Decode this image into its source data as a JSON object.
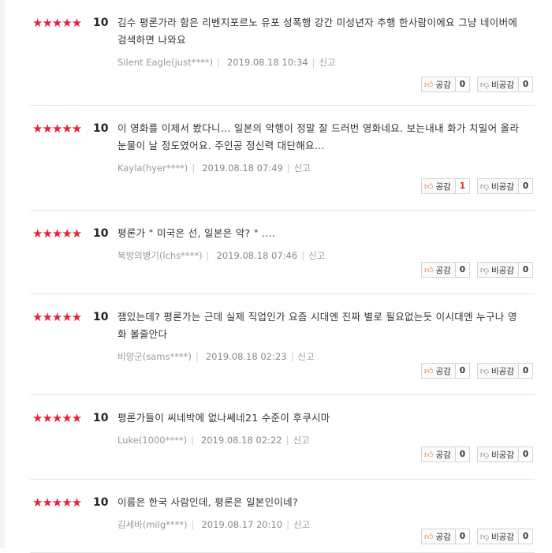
{
  "reviews": [
    {
      "stars": "★★★★★",
      "score": "10",
      "text": "김수 평론가라 함은 리벤지포르노 유포 성폭행 강간 미성년자 추행 한사람이에요 그냥 네이버에 검색하면 나와요",
      "author": "Silent Eagle(just****)",
      "date": "2019.08.18 10:34",
      "report": "신고",
      "like_label": "공감",
      "like": "0",
      "dislike_label": "비공감",
      "dislike": "0"
    },
    {
      "stars": "★★★★★",
      "score": "10",
      "text": "이 영화를 이제서 봤다니... 일본의 악행이 정말 잘 드러번 영화네요. 보는내내 화가 치밀어 올라 눈물이 날 정도였어요. 주인공 정신력 대단해요...",
      "author": "Kayla(hyer****)",
      "date": "2019.08.18 07:49",
      "report": "신고",
      "like_label": "공감",
      "like": "1",
      "dislike_label": "비공감",
      "dislike": "0"
    },
    {
      "stars": "★★★★★",
      "score": "10",
      "text": "평론가 \" 미국은 선, 일본은 악? \" ....",
      "author": "북방의병기(lchs****)",
      "date": "2019.08.18 07:46",
      "report": "신고",
      "like_label": "공감",
      "like": "0",
      "dislike_label": "비공감",
      "dislike": "0"
    },
    {
      "stars": "★★★★★",
      "score": "10",
      "text": "잼있는데? 평론가는 근데 실제 직업인가 요즘 시대엔 진짜 별로 필요없는듯 이시대엔 누구나 영화 볼줄안다",
      "author": "비양군(sams****)",
      "date": "2019.08.18 02:23",
      "report": "신고",
      "like_label": "공감",
      "like": "0",
      "dislike_label": "비공감",
      "dislike": "0"
    },
    {
      "stars": "★★★★★",
      "score": "10",
      "text": "평론가들이 씨네박에 없나쎄네21 수준이 후쿠시마",
      "author": "Luke(1000****)",
      "date": "2019.08.18 02:22",
      "report": "신고",
      "like_label": "공감",
      "like": "0",
      "dislike_label": "비공감",
      "dislike": "0"
    },
    {
      "stars": "★★★★★",
      "score": "10",
      "text": "이름은 한국 사람인데, 평론은 일본인이네?",
      "author": "김세바(milg****)",
      "date": "2019.08.17 20:10",
      "report": "신고",
      "like_label": "공감",
      "like": "0",
      "dislike_label": "비공감",
      "dislike": "0"
    }
  ],
  "icons": {
    "like": "thumbs-up-icon",
    "dislike": "thumbs-down-icon"
  },
  "colors": {
    "star": "#e8203a",
    "like_icon": "#e1783a",
    "like_count_positive": "#d0341c"
  }
}
